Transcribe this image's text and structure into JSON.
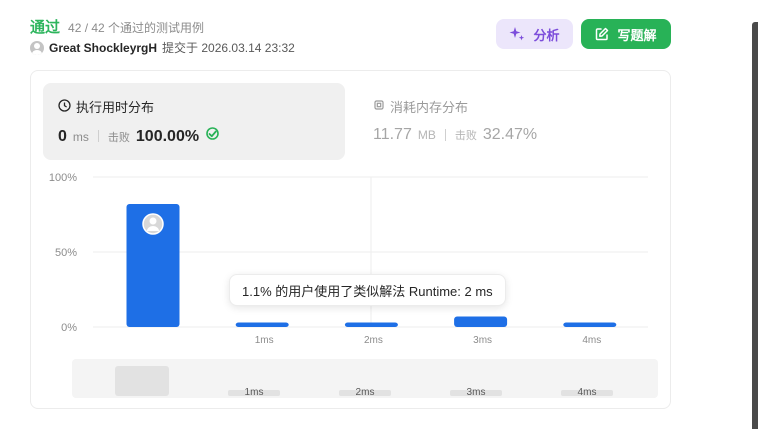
{
  "header": {
    "status": "通过",
    "testcases": "42 / 42 个通过的测试用例",
    "username": "Great ShockleyrgH",
    "submitted": "提交于 2026.03.14 23:32"
  },
  "buttons": {
    "analyze_label": "分析",
    "solution_label": "写题解"
  },
  "runtime": {
    "title": "执行用时分布",
    "value": "0",
    "unit": "ms",
    "beat_label": "击败",
    "beat_value": "100.00%"
  },
  "memory": {
    "title": "消耗内存分布",
    "value": "11.77",
    "unit": "MB",
    "beat_label": "击败",
    "beat_value": "32.47%"
  },
  "chart_data": {
    "type": "bar",
    "categories": [
      "0ms",
      "1ms",
      "2ms",
      "3ms",
      "4ms"
    ],
    "x_tick_labels": [
      "",
      "1ms",
      "2ms",
      "3ms",
      "4ms"
    ],
    "values": [
      82,
      3,
      3,
      7,
      3
    ],
    "y_ticks": [
      "0%",
      "50%",
      "100%"
    ],
    "ylim": [
      0,
      100
    ],
    "highlight_index": 0,
    "bar_color": "#1e6fe6",
    "grid": true
  },
  "tooltip": {
    "text": "1.1% 的用户使用了类似解法 Runtime: 2 ms"
  },
  "brush": {
    "labels": [
      "1ms",
      "2ms",
      "3ms",
      "4ms"
    ]
  }
}
